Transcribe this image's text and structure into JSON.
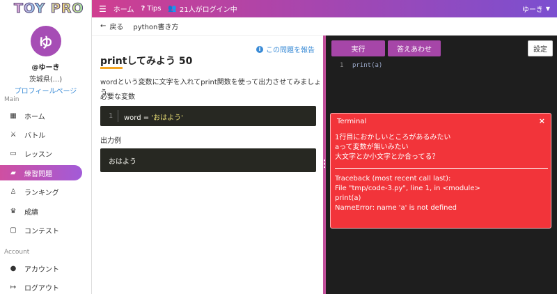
{
  "logo": "TOY PRO",
  "header": {
    "home": "ホーム",
    "tips": "Tips",
    "online": "21人がログイン中",
    "user": "ゆーき"
  },
  "profile": {
    "avatar_char": "ゆ",
    "name": "@ゆーき",
    "pref": "茨城県(...)",
    "link": "プロフィールページ"
  },
  "sidebar": {
    "main_label": "Main",
    "account_label": "Account",
    "items": [
      {
        "label": "ホーム"
      },
      {
        "label": "バトル"
      },
      {
        "label": "レッスン"
      },
      {
        "label": "練習問題"
      },
      {
        "label": "ランキング"
      },
      {
        "label": "成績"
      },
      {
        "label": "コンテスト"
      }
    ],
    "account_items": [
      {
        "label": "アカウント"
      },
      {
        "label": "ログアウト"
      }
    ]
  },
  "breadcrumb": {
    "back": "戻る",
    "title": "python書き方"
  },
  "problem": {
    "report": "この問題を報告",
    "title": "printしてみよう 50",
    "desc": "wordという変数に文字を入れてprint関数を使って出力させてみましょう。",
    "var_label": "必要な変数",
    "code_line_no": "1",
    "code_prefix": "word = ",
    "code_str": "'おはよう'",
    "output_label": "出力例",
    "output": "おはよう"
  },
  "editor": {
    "run": "実行",
    "answer": "答えあわせ",
    "settings": "設定",
    "line_no": "1",
    "code": "print(a)"
  },
  "terminal": {
    "title": "Terminal",
    "close": "×",
    "hints": [
      "1行目におかしいところがあるみたい",
      "aって変数が無いみたい",
      "大文字とか小文字とか合ってる？"
    ],
    "traceback": [
      "Traceback (most recent call last):",
      "File \"tmp/code-3.py\", line 1, in <module>",
      "print(a)",
      "NameError: name 'a' is not defined"
    ]
  },
  "colors": {
    "accent": "#a646a8",
    "header_start": "#cf3e90",
    "header_end": "#7b4fd0",
    "terminal_bg": "#f2343a"
  }
}
